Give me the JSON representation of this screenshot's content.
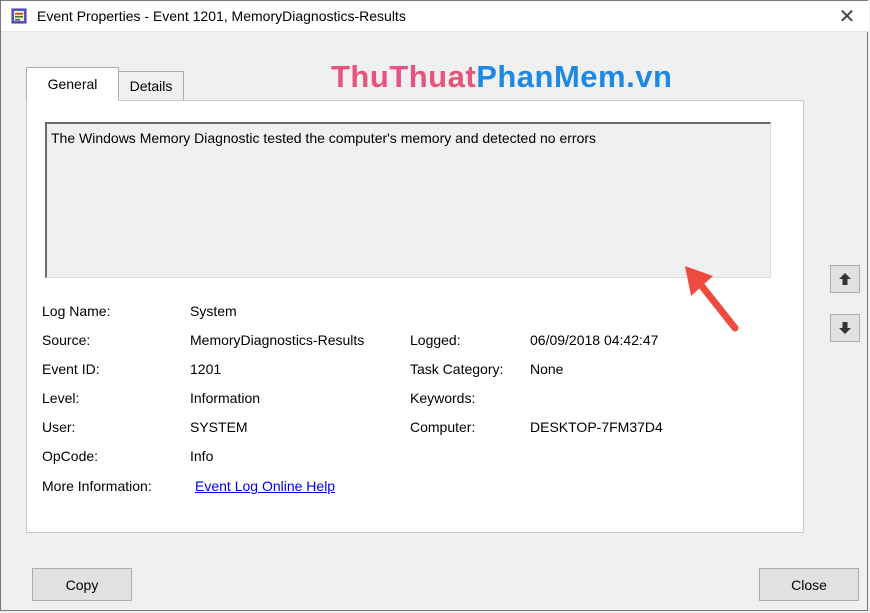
{
  "window": {
    "title": "Event Properties - Event 1201, MemoryDiagnostics-Results",
    "close_glyph": "✕"
  },
  "tabs": [
    {
      "label": "General",
      "active": true
    },
    {
      "label": "Details",
      "active": false
    }
  ],
  "watermark": {
    "part1": "ThuThuat",
    "part2": "PhanMem.vn"
  },
  "description": "The Windows Memory Diagnostic tested the computer's memory and detected no errors",
  "fields": {
    "log_name": {
      "label": "Log Name:",
      "value": "System"
    },
    "source": {
      "label": "Source:",
      "value": "MemoryDiagnostics-Results"
    },
    "logged": {
      "label": "Logged:",
      "value": "06/09/2018 04:42:47"
    },
    "event_id": {
      "label": "Event ID:",
      "value": "1201"
    },
    "task_category": {
      "label": "Task Category:",
      "value": "None"
    },
    "level": {
      "label": "Level:",
      "value": "Information"
    },
    "keywords": {
      "label": "Keywords:",
      "value": ""
    },
    "user": {
      "label": "User:",
      "value": "SYSTEM"
    },
    "computer": {
      "label": "Computer:",
      "value": "DESKTOP-7FM37D4"
    },
    "opcode": {
      "label": "OpCode:",
      "value": "Info"
    },
    "more_info": {
      "label": "More Information:",
      "value": "Event Log Online Help"
    }
  },
  "buttons": {
    "copy": "Copy",
    "close": "Close"
  },
  "icons": {
    "nav_up": "arrow-up-icon",
    "nav_down": "arrow-down-icon",
    "annotation": "red-arrow-icon"
  },
  "colors": {
    "watermark_pink": "#e75480",
    "watermark_blue": "#1e88e5",
    "link": "#0000ee",
    "annotation_arrow": "#ee4b3e"
  }
}
